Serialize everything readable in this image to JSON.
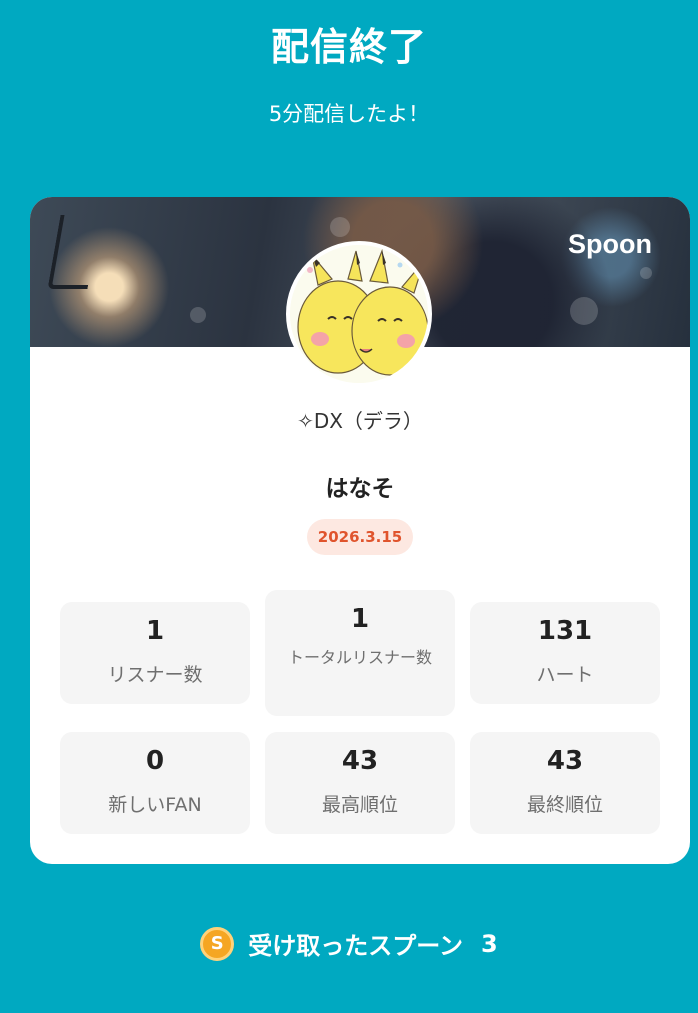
{
  "header": {
    "title": "配信終了",
    "subtitle": "5分配信したよ！"
  },
  "card": {
    "brand": "Spoon",
    "handle": "✧DX（デラ）",
    "name": "はなそ",
    "date": "2026.3.15",
    "stats": [
      {
        "value": "1",
        "label": "リスナー数"
      },
      {
        "value": "1",
        "label": "トータルリスナー数"
      },
      {
        "value": "131",
        "label": "ハート"
      },
      {
        "value": "0",
        "label": "新しいFAN"
      },
      {
        "value": "43",
        "label": "最高順位"
      },
      {
        "value": "43",
        "label": "最終順位"
      }
    ]
  },
  "footer": {
    "coin_glyph": "S",
    "text": "受け取ったスプーン",
    "count": "3"
  },
  "colors": {
    "background": "#00a9c1",
    "date_text": "#e0542d",
    "date_bg": "#fde8e1",
    "coin": "#f5a623"
  },
  "icons": [
    "spoon-coin-icon"
  ]
}
